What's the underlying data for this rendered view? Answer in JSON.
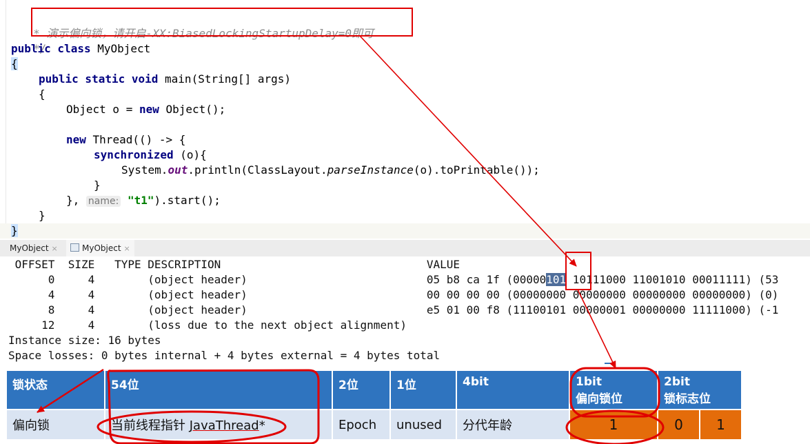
{
  "editor": {
    "comment_line_1": " * 演示偏向锁，请开启-XX:BiasedLockingStartupDelay=0即可",
    "comment_line_2": " */",
    "class_kw": "public class ",
    "class_name": "MyObject",
    "open_brace": "{",
    "method_kw": "public static void ",
    "method_sig": "main(String[] args)",
    "method_open": "{",
    "obj_decl_pre": "Object o = ",
    "obj_new_kw": "new",
    "obj_decl_post": " Object();",
    "thread_new_kw": "new",
    "thread_decl": " Thread(() -> {",
    "sync_kw": "synchronized",
    "sync_rest": " (o){",
    "print_pre": "System.",
    "print_out": "out",
    "print_mid": ".println(ClassLayout.",
    "print_parse": "parseInstance",
    "print_post": "(o).toPrintable());",
    "inner_close": "}",
    "thread_close_pre": "},",
    "hint_name": "name:",
    "thread_name": "\"t1\"",
    "thread_close_post": ").start();",
    "method_close": "}",
    "class_close": "}"
  },
  "tabs": [
    {
      "label": "MyObject",
      "close": "×"
    },
    {
      "label": "MyObject",
      "close": "×"
    }
  ],
  "console": {
    "header": " OFFSET  SIZE   TYPE DESCRIPTION                               VALUE",
    "rows": [
      {
        "pre": "      0     4        (object header)                           05 b8 ca 1f (00000",
        "sel": "101",
        "post": " 10111000 11001010 00011111) (53"
      },
      {
        "pre": "      4     4        (object header)                           00 00 00 00 (00000000 00000000 00000000 00000000) (0)",
        "sel": "",
        "post": ""
      },
      {
        "pre": "      8     4        (object header)                           e5 01 00 f8 (11100101 00000001 00000000 11111000) (-1",
        "sel": "",
        "post": ""
      },
      {
        "pre": "     12     4        (loss due to the next object alignment)",
        "sel": "",
        "post": ""
      }
    ],
    "instance_size": "Instance size: 16 bytes",
    "space_losses": "Space losses: 0 bytes internal + 4 bytes external = 4 bytes total"
  },
  "markword": {
    "headers": [
      "锁状态",
      "54位",
      "2位",
      "1位",
      "4bit",
      "1bit\n偏向锁位",
      "2bit\n锁标志位"
    ],
    "row": {
      "state": "偏向锁",
      "pointer_pre": "当前线程指针 ",
      "pointer_thread": "JavaThread",
      "pointer_post": "*",
      "epoch": "Epoch",
      "unused": "unused",
      "age": "分代年龄",
      "biased_bit": "1",
      "lock_flag_0": "0",
      "lock_flag_1": "1"
    }
  },
  "colors": {
    "annotation_red": "#e00000",
    "table_header_blue": "#2f74bf",
    "table_row_blue": "#dae4f2",
    "bit_orange": "#e46c0a"
  }
}
